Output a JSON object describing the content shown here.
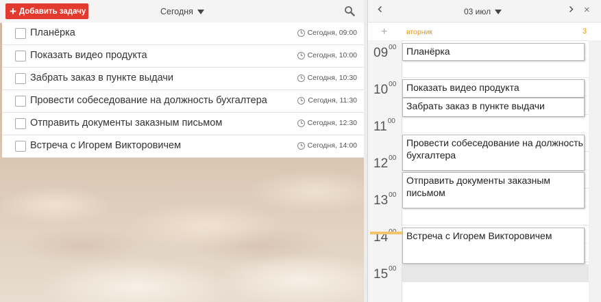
{
  "toolbar": {
    "add_label": "Добавить задачу",
    "filter_label": "Сегодня",
    "search_icon": "search-icon"
  },
  "tasks": [
    {
      "title": "Планёрка",
      "due": "Сегодня, 09:00"
    },
    {
      "title": "Показать видео продукта",
      "due": "Сегодня, 10:00"
    },
    {
      "title": "Забрать заказ в пункте выдачи",
      "due": "Сегодня, 10:30"
    },
    {
      "title": "Провести собеседование на должность бухгалтера",
      "due": "Сегодня, 11:30"
    },
    {
      "title": "Отправить документы заказным письмом",
      "due": "Сегодня, 12:30"
    },
    {
      "title": "Встреча с Игорем Викторовичем",
      "due": "Сегодня, 14:00"
    }
  ],
  "calendar": {
    "date_label": "03 июл",
    "day_name": "вторник",
    "day_number": "3",
    "plus": "+",
    "close": "×",
    "hours": [
      {
        "h": "09",
        "m": "00"
      },
      {
        "h": "10",
        "m": "00"
      },
      {
        "h": "11",
        "m": "00"
      },
      {
        "h": "12",
        "m": "00"
      },
      {
        "h": "13",
        "m": "00"
      },
      {
        "h": "14",
        "m": "00"
      },
      {
        "h": "15",
        "m": "00"
      }
    ],
    "events": [
      {
        "title": "Планёрка"
      },
      {
        "title": "Показать видео продукта"
      },
      {
        "title": "Забрать заказ в пункте выдачи"
      },
      {
        "title": "Провести собеседование на должность бухгалтера"
      },
      {
        "title": "Отправить документы заказным письмом"
      },
      {
        "title": "Встреча с Игорем Викторовичем"
      }
    ]
  },
  "colors": {
    "accent_red": "#e23a2f",
    "accent_orange": "#f39200",
    "now_marker": "#f5c36c"
  }
}
